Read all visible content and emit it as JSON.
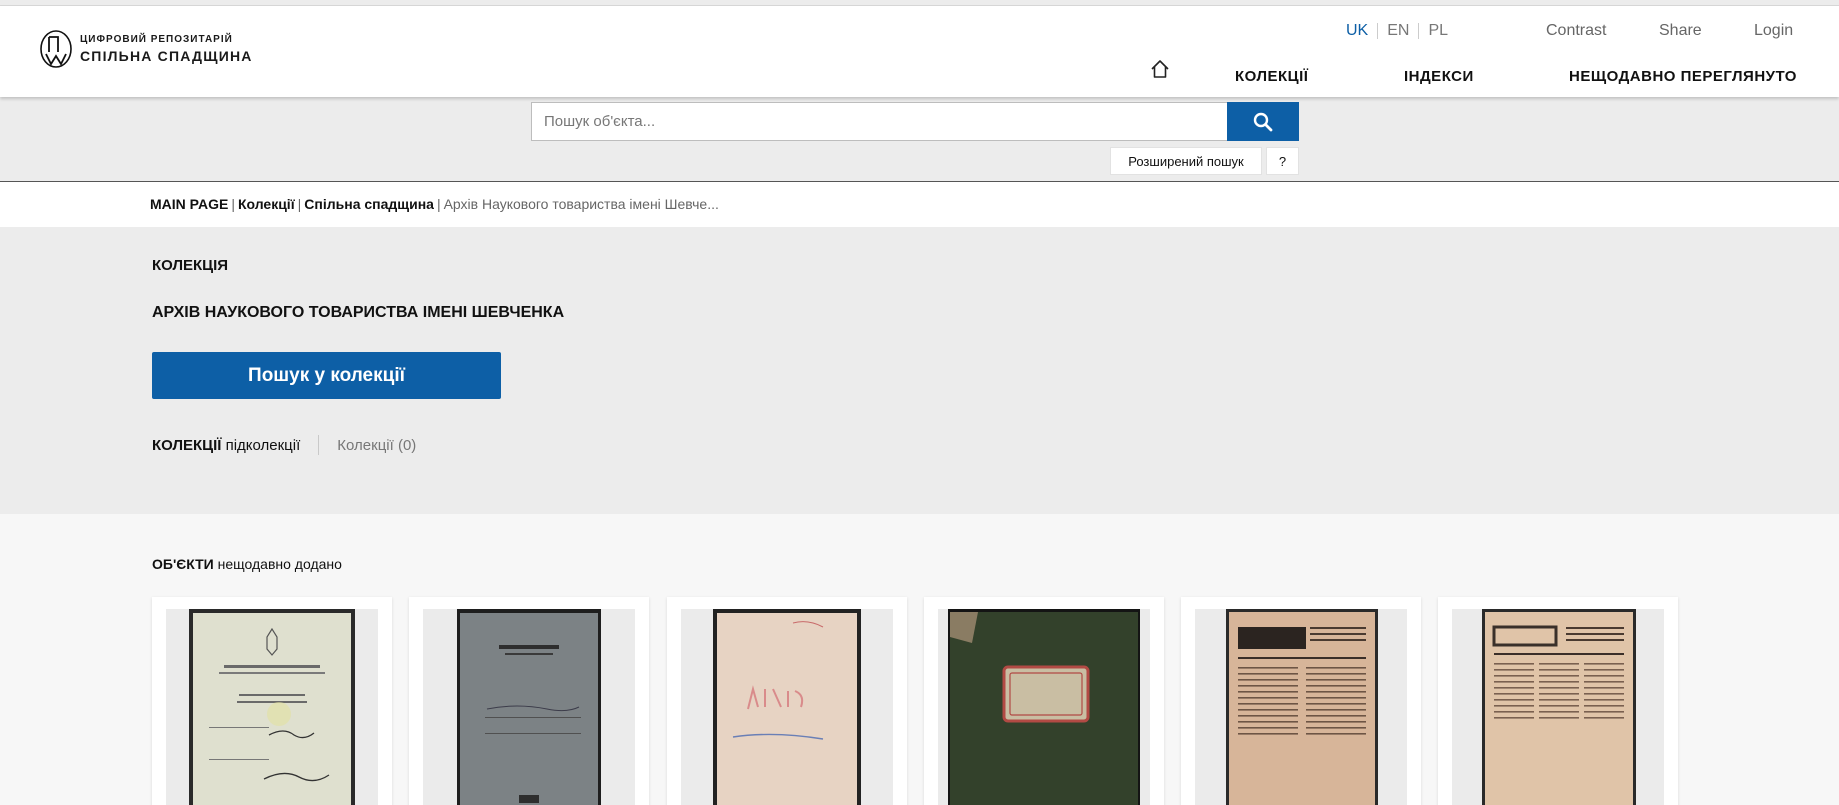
{
  "header": {
    "logo_line1": "ЦИФРОВИЙ РЕПОЗИТАРІЙ",
    "logo_line2": "СПІЛЬНА СПАДЩИНА",
    "languages": [
      "UK",
      "EN",
      "PL"
    ],
    "active_language": "UK",
    "contrast_label": "Contrast",
    "share_label": "Share",
    "login_label": "Login",
    "nav": {
      "collections": "КОЛЕКЦІЇ",
      "indexes": "ІНДЕКСИ",
      "recently_viewed": "НЕЩОДАВНО ПЕРЕГЛЯНУТО"
    }
  },
  "search": {
    "placeholder": "Пошук об'єкта...",
    "advanced_label": "Розширений пошук",
    "help_label": "?"
  },
  "breadcrumb": {
    "items": [
      "MAIN PAGE",
      "Колекції",
      "Спільна спадщина"
    ],
    "current": "Архів Наукового товариства імені Шевче..."
  },
  "collection": {
    "label": "КОЛЕКЦІЯ",
    "title": "АРХІВ НАУКОВОГО ТОВАРИСТВА ІМЕНІ ШЕВЧЕНКА",
    "search_button": "Пошук у колекції",
    "subcollections_bold": "КОЛЕКЦІЇ",
    "subcollections_rest": " підколекції",
    "subcollections_count": "Колекції (0)"
  },
  "objects": {
    "heading_bold": "ОБ'ЄКТИ",
    "heading_rest": " нещодавно додано",
    "items": [
      {
        "name": "passport-document"
      },
      {
        "name": "notebook-skoroszyt"
      },
      {
        "name": "visy-manuscript"
      },
      {
        "name": "green-ledger"
      },
      {
        "name": "vpered-newspaper"
      },
      {
        "name": "wpered-newspaper"
      }
    ]
  },
  "colors": {
    "accent": "#0d5fa6",
    "band_gray": "#ececec"
  }
}
